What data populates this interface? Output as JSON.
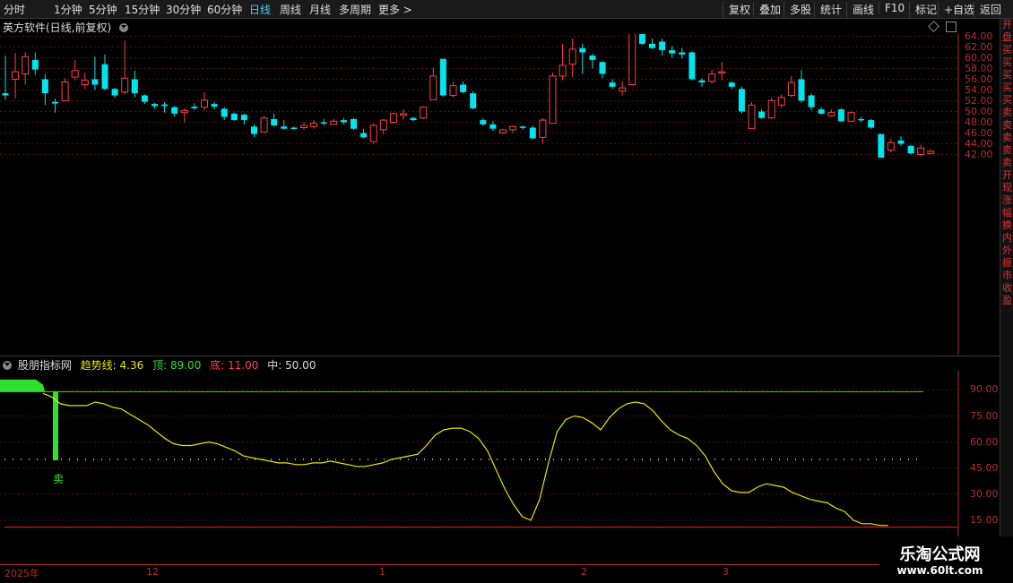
{
  "toolbar": {
    "periods": [
      "分时",
      "1分钟",
      "5分钟",
      "15分钟",
      "30分钟",
      "60分钟",
      "日线",
      "周线",
      "月线",
      "多周期",
      "更多 >"
    ],
    "active_period": "日线",
    "actions": [
      "复权",
      "叠加",
      "多股",
      "统计",
      "画线",
      "F10",
      "标记",
      "+自选",
      "返回"
    ]
  },
  "main_panel": {
    "title": "英方软件(日线,前复权)",
    "price_axis": [
      "64.00",
      "62.00",
      "60.00",
      "58.00",
      "56.00",
      "54.00",
      "52.00",
      "50.00",
      "48.00",
      "46.00",
      "44.00",
      "42.00"
    ],
    "candles": [
      [
        53.4,
        53.0,
        60.4,
        52.2
      ],
      [
        56.0,
        57.4,
        60.9,
        52.4
      ],
      [
        57.0,
        60.2,
        61.0,
        55.0
      ],
      [
        59.6,
        57.8,
        61.0,
        56.8
      ],
      [
        56.0,
        53.4,
        57.0,
        51.2
      ],
      [
        51.8,
        51.5,
        52.4,
        49.8
      ],
      [
        52.0,
        55.5,
        56.2,
        52.0
      ],
      [
        56.4,
        57.6,
        59.6,
        55.8
      ],
      [
        55.0,
        55.8,
        57.2,
        54.2
      ],
      [
        56.0,
        55.0,
        60.2,
        54.0
      ],
      [
        58.8,
        54.2,
        60.6,
        54.0
      ],
      [
        54.2,
        53.0,
        54.4,
        52.5
      ],
      [
        53.6,
        56.2,
        63.2,
        53.2
      ],
      [
        56.0,
        53.4,
        57.6,
        52.6
      ],
      [
        53.0,
        51.8,
        53.2,
        51.4
      ],
      [
        51.4,
        51.0,
        51.6,
        50.5
      ],
      [
        51.3,
        51.0,
        51.8,
        49.8
      ],
      [
        50.8,
        49.6,
        51.0,
        49.0
      ],
      [
        49.8,
        50.2,
        50.6,
        48.0
      ],
      [
        50.9,
        50.6,
        51.5,
        50.3
      ],
      [
        50.8,
        52.1,
        53.6,
        50.2
      ],
      [
        51.4,
        50.9,
        51.8,
        50.4
      ],
      [
        50.5,
        49.0,
        50.8,
        48.4
      ],
      [
        49.6,
        48.4,
        49.8,
        48.3
      ],
      [
        49.4,
        48.4,
        49.6,
        47.6
      ],
      [
        47.2,
        45.8,
        47.6,
        45.2
      ],
      [
        46.2,
        48.8,
        49.2,
        46.2
      ],
      [
        48.6,
        47.4,
        49.6,
        47.2
      ],
      [
        47.2,
        46.8,
        48.4,
        46.6
      ],
      [
        47.0,
        46.8,
        47.2,
        46.6
      ],
      [
        47.0,
        47.4,
        48.0,
        46.6
      ],
      [
        47.2,
        47.8,
        48.4,
        46.8
      ],
      [
        48.0,
        47.8,
        48.6,
        47.4
      ],
      [
        47.6,
        48.2,
        48.6,
        47.6
      ],
      [
        48.4,
        48.0,
        48.8,
        47.6
      ],
      [
        48.6,
        46.8,
        48.8,
        46.6
      ],
      [
        46.0,
        45.2,
        46.8,
        45.0
      ],
      [
        44.4,
        47.4,
        47.8,
        44.0
      ],
      [
        46.6,
        48.4,
        48.6,
        45.8
      ],
      [
        48.0,
        49.6,
        49.8,
        47.8
      ],
      [
        49.3,
        49.6,
        50.4,
        48.5
      ],
      [
        48.8,
        48.4,
        49.0,
        48.2
      ],
      [
        48.8,
        50.8,
        51.0,
        48.6
      ],
      [
        52.2,
        56.6,
        58.2,
        52.4
      ],
      [
        59.8,
        53.0,
        59.8,
        52.8
      ],
      [
        53.0,
        54.8,
        55.6,
        52.6
      ],
      [
        55.0,
        53.6,
        55.6,
        53.4
      ],
      [
        53.4,
        50.6,
        53.8,
        50.4
      ],
      [
        48.4,
        47.6,
        48.8,
        47.4
      ],
      [
        47.6,
        46.8,
        48.2,
        46.4
      ],
      [
        46.0,
        46.6,
        46.8,
        45.8
      ],
      [
        46.6,
        47.2,
        47.4,
        46.0
      ],
      [
        47.2,
        47.0,
        47.4,
        46.6
      ],
      [
        47.0,
        45.0,
        47.4,
        44.8
      ],
      [
        45.2,
        48.4,
        48.8,
        44.0
      ],
      [
        47.8,
        56.6,
        57.2,
        47.8
      ],
      [
        56.6,
        58.6,
        62.6,
        55.8
      ],
      [
        58.8,
        61.6,
        63.6,
        56.4
      ],
      [
        61.8,
        61.0,
        62.6,
        57.0
      ],
      [
        60.4,
        59.6,
        60.8,
        58.0
      ],
      [
        59.2,
        57.0,
        59.4,
        56.2
      ],
      [
        55.4,
        54.6,
        56.0,
        54.2
      ],
      [
        53.8,
        54.4,
        55.6,
        53.0
      ],
      [
        55.0,
        65.2,
        66.4,
        54.8
      ],
      [
        65.2,
        62.6,
        65.6,
        62.4
      ],
      [
        62.6,
        61.8,
        63.6,
        61.6
      ],
      [
        63.0,
        61.4,
        63.6,
        60.4
      ],
      [
        61.4,
        60.8,
        62.2,
        60.0
      ],
      [
        61.0,
        60.6,
        61.8,
        59.8
      ],
      [
        61.0,
        56.0,
        61.2,
        55.8
      ],
      [
        55.8,
        55.4,
        56.2,
        54.6
      ],
      [
        55.6,
        57.0,
        57.8,
        55.2
      ],
      [
        57.2,
        57.4,
        59.2,
        55.8
      ],
      [
        55.4,
        54.6,
        55.6,
        54.2
      ],
      [
        54.2,
        50.0,
        54.6,
        49.6
      ],
      [
        46.8,
        51.2,
        51.8,
        46.8
      ],
      [
        50.0,
        48.8,
        50.4,
        48.6
      ],
      [
        48.8,
        52.0,
        52.6,
        48.6
      ],
      [
        51.2,
        52.6,
        53.2,
        50.6
      ],
      [
        53.0,
        55.4,
        56.6,
        52.6
      ],
      [
        56.0,
        52.0,
        57.8,
        51.6
      ],
      [
        53.0,
        50.8,
        53.4,
        50.2
      ],
      [
        50.4,
        49.6,
        50.8,
        49.4
      ],
      [
        49.2,
        49.8,
        50.4,
        49.0
      ],
      [
        50.4,
        48.2,
        50.6,
        48.0
      ],
      [
        48.2,
        49.8,
        50.0,
        48.2
      ],
      [
        48.6,
        48.4,
        49.0,
        48.0
      ],
      [
        48.4,
        47.0,
        48.6,
        46.8
      ],
      [
        45.8,
        41.4,
        45.8,
        41.4
      ],
      [
        42.8,
        44.2,
        45.0,
        42.4
      ],
      [
        44.6,
        44.0,
        45.4,
        43.6
      ],
      [
        43.6,
        42.2,
        43.8,
        42.0
      ],
      [
        42.0,
        43.2,
        43.8,
        41.6
      ],
      [
        42.2,
        42.6,
        42.9,
        42.0
      ]
    ],
    "right_strip_chars": [
      "开",
      "盘",
      "买",
      "买",
      "买",
      "买",
      "买",
      "卖",
      "卖",
      "卖",
      "卖",
      "卖",
      "开",
      "现",
      "涨",
      "幅",
      "换",
      "内",
      "外",
      "振",
      "市",
      "收",
      "盈"
    ]
  },
  "indicator_panel": {
    "name": "股朋指标网",
    "trend_label": "趋势线:",
    "trend_value": "4.36",
    "top_label": "顶:",
    "top_value": "89.00",
    "bottom_label": "底:",
    "bottom_value": "11.00",
    "mid_label": "中:",
    "mid_value": "50.00",
    "axis": [
      "90.00",
      "75.00",
      "60.00",
      "45.00",
      "30.00",
      "15.00"
    ],
    "sell_label": "卖",
    "trend_series": [
      88,
      86,
      82,
      81,
      81,
      81,
      83,
      82,
      80,
      79,
      76,
      73,
      70,
      66,
      62,
      59,
      58,
      58,
      59,
      60,
      59,
      57,
      55,
      52,
      51,
      50,
      49,
      48,
      48,
      47,
      47,
      48,
      48,
      49,
      48,
      47,
      46,
      46,
      47,
      48,
      50,
      51,
      52,
      53,
      58,
      64,
      67,
      68,
      68,
      66,
      62,
      55,
      44,
      33,
      24,
      17,
      15,
      27,
      48,
      66,
      73,
      75,
      74,
      71,
      67,
      74,
      79,
      82,
      83,
      82,
      78,
      72,
      67,
      64,
      62,
      58,
      52,
      43,
      36,
      32,
      31,
      31,
      34,
      36,
      35,
      34,
      31,
      29,
      27,
      26,
      25,
      22,
      20,
      15,
      13,
      13,
      12,
      12
    ]
  },
  "date_axis": [
    "2025年",
    "12",
    "1",
    "2",
    "3"
  ],
  "watermark": {
    "title": "乐淘公式网",
    "url": "www.60lt.com"
  },
  "colors": {
    "up": "#ff4040",
    "down": "#00e5ee",
    "grid": "#5a1010",
    "trend": "#e6e600",
    "sell": "#30e030",
    "active_tab": "#3fd0ff"
  }
}
